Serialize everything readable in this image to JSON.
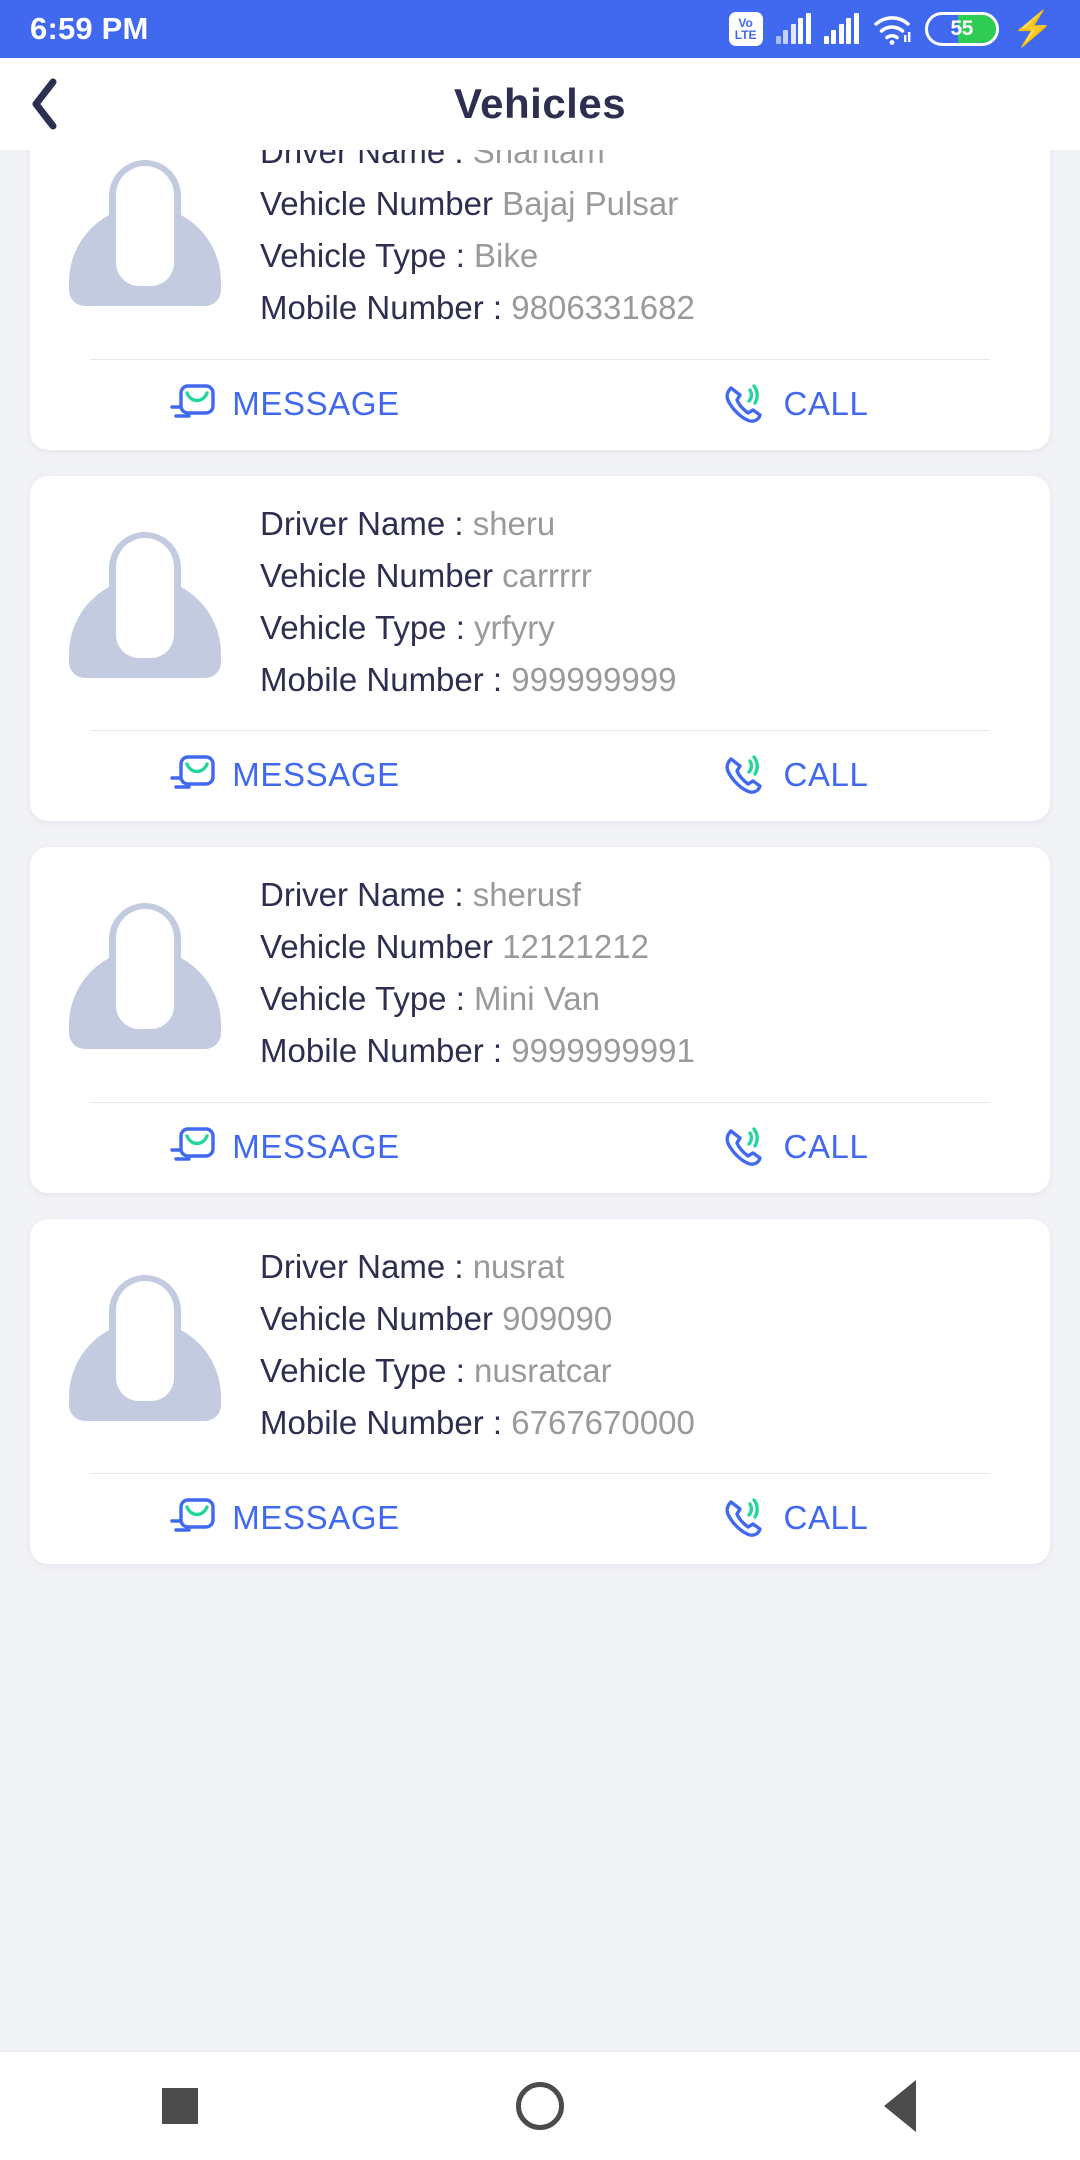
{
  "status_bar": {
    "time": "6:59 PM",
    "volte_top": "Vo",
    "volte_bottom": "LTE",
    "battery_level": "55",
    "icons": [
      "volte-icon",
      "signal-bars-icon",
      "signal-bars-icon",
      "wifi-icon",
      "battery-icon",
      "charging-bolt-icon"
    ],
    "colors": {
      "background": "#4069f0",
      "battery_fill": "#2ecc52",
      "foreground": "#ffffff"
    }
  },
  "app_bar": {
    "back_icon": "chevron-left-icon",
    "title": "Vehicles"
  },
  "labels": {
    "driver_name": "Driver Name :",
    "vehicle_number": "Vehicle Number",
    "vehicle_type": "Vehicle Type :",
    "mobile_number": "Mobile Number :"
  },
  "actions": {
    "message_label": "MESSAGE",
    "call_label": "CALL",
    "message_icon": "message-envelope-icon",
    "call_icon": "phone-call-icon"
  },
  "colors": {
    "accent": "#4069f0",
    "label_text": "#2e2e50",
    "value_text": "#9a9a9a",
    "page_background": "#f2f3f7",
    "card_background": "#ffffff",
    "avatar": "#c3cbe0",
    "icon_green": "#23d6a0"
  },
  "vehicles": [
    {
      "driver_name": "Shantam",
      "vehicle_number": "Bajaj Pulsar",
      "vehicle_type": "Bike",
      "mobile_number": "9806331682"
    },
    {
      "driver_name": "sheru",
      "vehicle_number": "carrrrr",
      "vehicle_type": "yrfyry",
      "mobile_number": "999999999"
    },
    {
      "driver_name": "sherusf",
      "vehicle_number": "12121212",
      "vehicle_type": "Mini Van",
      "mobile_number": "9999999991"
    },
    {
      "driver_name": "nusrat",
      "vehicle_number": "909090",
      "vehicle_type": "nusratcar",
      "mobile_number": "6767670000"
    }
  ],
  "nav_bar": {
    "recents_icon": "square-recents-icon",
    "home_icon": "circle-home-icon",
    "back_icon": "triangle-back-icon"
  }
}
